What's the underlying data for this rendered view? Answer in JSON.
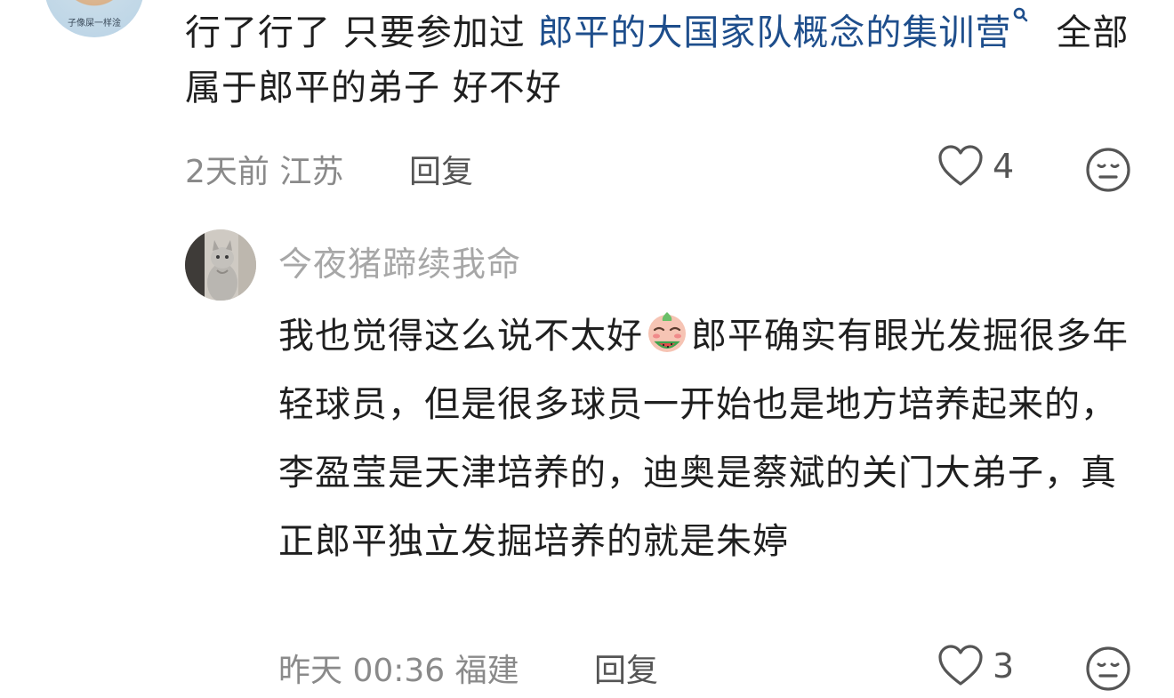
{
  "comment1": {
    "avatar_caption": "子像屎一样淦",
    "text_before_link": "行了行了  只要参加过 ",
    "link_text": "郎平的大国家队概念的集训营",
    "text_after_link": "全部属于郎平的弟子  好不好",
    "meta": "2天前 江苏",
    "reply_label": "回复",
    "like_count": "4"
  },
  "comment2": {
    "username": "今夜猪蹄续我命",
    "text_part1": "我也觉得这么说不太好",
    "emoji_name": "watermelon-emoji",
    "text_part2": "郎平确实有眼光发掘很多年轻球员，但是很多球员一开始也是地方培养起来的，李盈莹是天津培养的，迪奥是蔡斌的关门大弟子，真正郎平独立发掘培养的就是朱婷",
    "meta": "昨天 00:36 福建",
    "reply_label": "回复",
    "like_count": "3"
  },
  "colors": {
    "link": "#1e4e8c",
    "meta": "#8a8a8a",
    "username": "#a7a7a7"
  }
}
